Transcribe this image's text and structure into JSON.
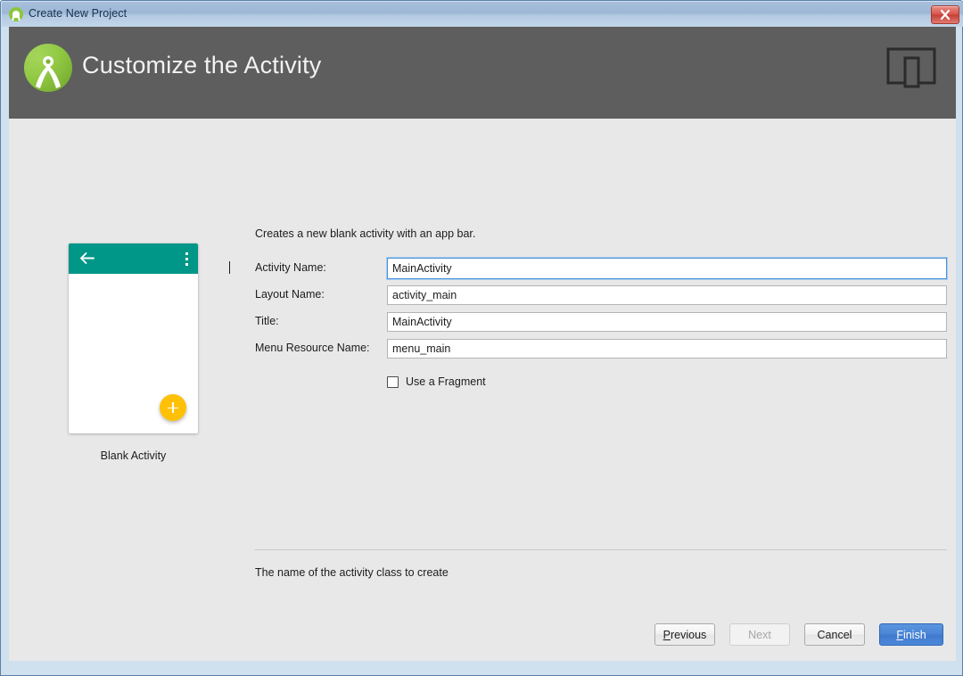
{
  "window": {
    "title": "Create New Project",
    "app_icon": "android-studio-icon",
    "close_label": "close-icon"
  },
  "header": {
    "title": "Customize the Activity",
    "logo": "android-studio-logo",
    "device_icon": "tablet-phone-icon",
    "background_color": "#5e5e5e"
  },
  "preview": {
    "caption": "Blank Activity",
    "appbar_color": "#009688",
    "fab_color": "#ffc107",
    "back_icon": "arrow-back-icon",
    "overflow_icon": "overflow-menu-icon",
    "fab_icon": "plus-icon"
  },
  "form": {
    "description": "Creates a new blank activity with an app bar.",
    "fields": [
      {
        "label": "Activity Name:",
        "value": "MainActivity",
        "focused": true
      },
      {
        "label": "Layout Name:",
        "value": "activity_main",
        "focused": false
      },
      {
        "label": "Title:",
        "value": "MainActivity",
        "focused": false
      },
      {
        "label": "Menu Resource Name:",
        "value": "menu_main",
        "focused": false
      }
    ],
    "checkbox": {
      "label": "Use a Fragment",
      "checked": false
    },
    "help_text": "The name of the activity class to create"
  },
  "buttons": {
    "previous": {
      "label": "Previous",
      "mnemonic": "P",
      "state": "enabled"
    },
    "next": {
      "label": "Next",
      "state": "disabled"
    },
    "cancel": {
      "label": "Cancel",
      "state": "enabled"
    },
    "finish": {
      "label": "Finish",
      "mnemonic": "F",
      "state": "default"
    }
  },
  "colors": {
    "accent_blue": "#4a86d6",
    "teal": "#009688",
    "amber": "#ffc107",
    "body_bg": "#e8e8e8",
    "header_bg": "#5e5e5e"
  }
}
